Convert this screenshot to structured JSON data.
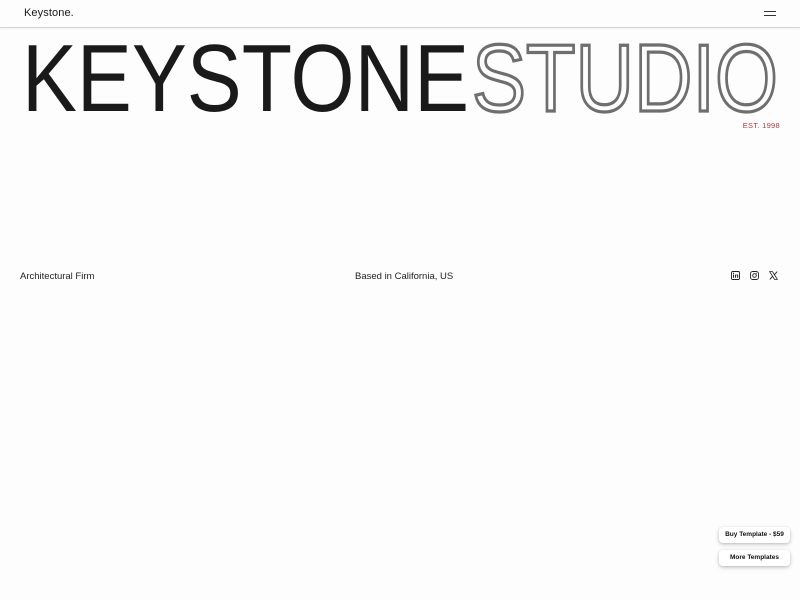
{
  "header": {
    "logo": "Keystone."
  },
  "hero": {
    "word_primary": "KEYSTONE",
    "word_secondary": "STUDIO",
    "established": "EST. 1998"
  },
  "info": {
    "left_text": "Architectural Firm",
    "center_text": "Based in California, US"
  },
  "socials": [
    {
      "icon": "linkedin-icon"
    },
    {
      "icon": "instagram-icon"
    },
    {
      "icon": "x-icon"
    }
  ],
  "cta": {
    "buy_label": "Buy Template - $59",
    "more_label": "More Templates"
  },
  "colors": {
    "primary_text": "#1a1a1a",
    "secondary_text": "#6e6e6e",
    "accent": "#b33a3a",
    "background": "#fdfdfd"
  }
}
